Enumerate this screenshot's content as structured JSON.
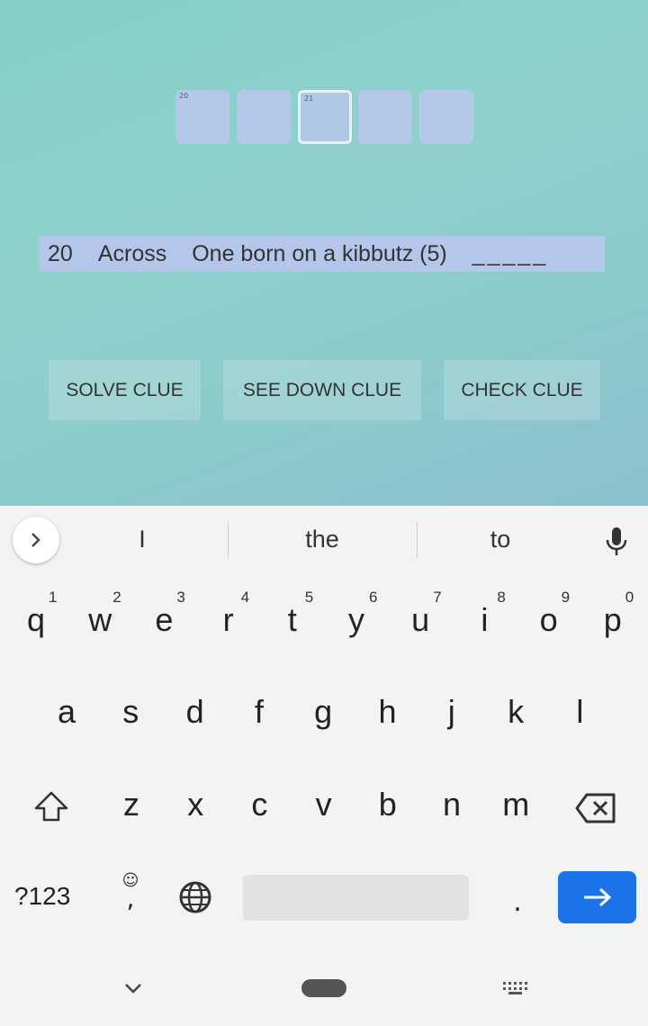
{
  "grid": {
    "cells": [
      {
        "number": "20"
      },
      {
        "number": ""
      },
      {
        "number": "21",
        "selected": true
      },
      {
        "number": ""
      },
      {
        "number": ""
      }
    ]
  },
  "clue": {
    "number": "20",
    "direction": "Across",
    "text": "One born on a kibbutz (5)",
    "pattern": "_____"
  },
  "buttons": {
    "solve": "SOLVE CLUE",
    "see_down": "SEE DOWN CLUE",
    "check": "CHECK CLUE"
  },
  "suggestions": [
    "I",
    "the",
    "to"
  ],
  "keyboard": {
    "row1": [
      "q",
      "w",
      "e",
      "r",
      "t",
      "y",
      "u",
      "i",
      "o",
      "p"
    ],
    "row1_hints": [
      "1",
      "2",
      "3",
      "4",
      "5",
      "6",
      "7",
      "8",
      "9",
      "0"
    ],
    "row2": [
      "a",
      "s",
      "d",
      "f",
      "g",
      "h",
      "j",
      "k",
      "l"
    ],
    "row3": [
      "z",
      "x",
      "c",
      "v",
      "b",
      "n",
      "m"
    ],
    "symbols": "?123",
    "comma": ",",
    "period": "."
  },
  "colors": {
    "accent": "#1a73e8"
  }
}
